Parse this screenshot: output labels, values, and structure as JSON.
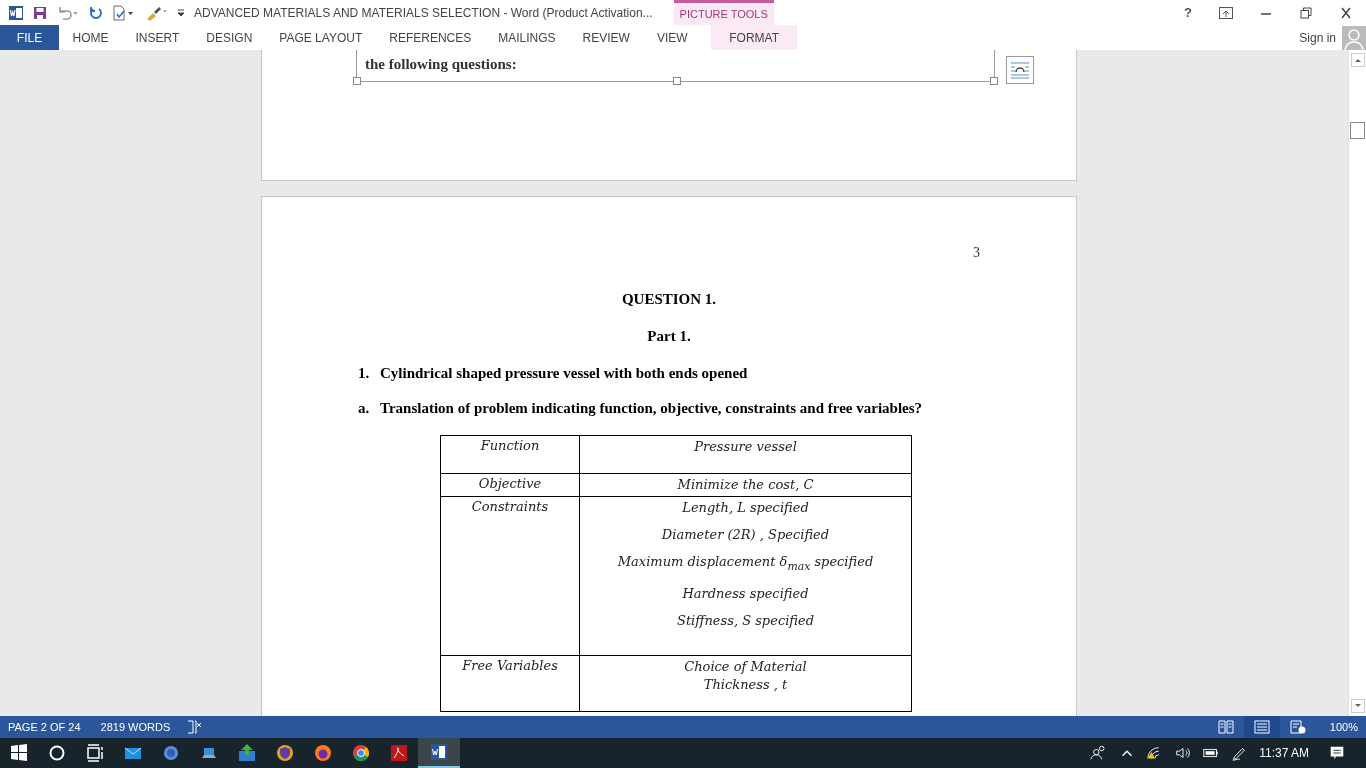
{
  "title_bar": {
    "title": "ADVANCED MATERIALS AND MATERIALS SELECTION - Word (Product Activation...",
    "contextual_group": "PICTURE TOOLS",
    "help": "?"
  },
  "ribbon_tabs": [
    {
      "label": "FILE",
      "kind": "file",
      "selected": false
    },
    {
      "label": "HOME",
      "kind": "normal",
      "selected": false
    },
    {
      "label": "INSERT",
      "kind": "normal",
      "selected": false
    },
    {
      "label": "DESIGN",
      "kind": "normal",
      "selected": false
    },
    {
      "label": "PAGE LAYOUT",
      "kind": "normal",
      "selected": false
    },
    {
      "label": "REFERENCES",
      "kind": "normal",
      "selected": false
    },
    {
      "label": "MAILINGS",
      "kind": "normal",
      "selected": false
    },
    {
      "label": "REVIEW",
      "kind": "normal",
      "selected": false
    },
    {
      "label": "VIEW",
      "kind": "normal",
      "selected": false
    },
    {
      "label": "FORMAT",
      "kind": "contextual",
      "selected": false
    }
  ],
  "sign_in": "Sign in",
  "document": {
    "prev_page_text": "the following questions:",
    "page_number": "3",
    "heading": "QUESTION 1.",
    "subheading": "Part 1.",
    "items": [
      {
        "marker": "1.",
        "text": "Cylindrical shaped pressure vessel with both ends opened"
      },
      {
        "marker": "a.",
        "text": "Translation of problem indicating function, objective, constraints and free variables?"
      }
    ],
    "table": {
      "rows": [
        {
          "label": "Function",
          "values": [
            "Pressure vessel"
          ]
        },
        {
          "label": "Objective",
          "values": [
            "Minimize the cost, C"
          ]
        },
        {
          "label": "Constraints",
          "values": [
            "Length, L specified",
            "Diameter (2R) , Specified",
            "Maximum displacement δ$_{max}$ specified",
            "Hardness specified",
            "Stiffness, S specified"
          ]
        },
        {
          "label": "Free Variables",
          "values": [
            "Choice of Material",
            "Thickness , t"
          ]
        }
      ]
    }
  },
  "status_bar": {
    "page": "PAGE 2 OF 24",
    "words": "2819 WORDS",
    "zoom": "100%",
    "views": [
      {
        "kind": "read",
        "selected": false
      },
      {
        "kind": "print",
        "selected": true
      },
      {
        "kind": "web",
        "selected": false
      }
    ]
  },
  "taskbar": {
    "time": "11:37 AM"
  }
}
